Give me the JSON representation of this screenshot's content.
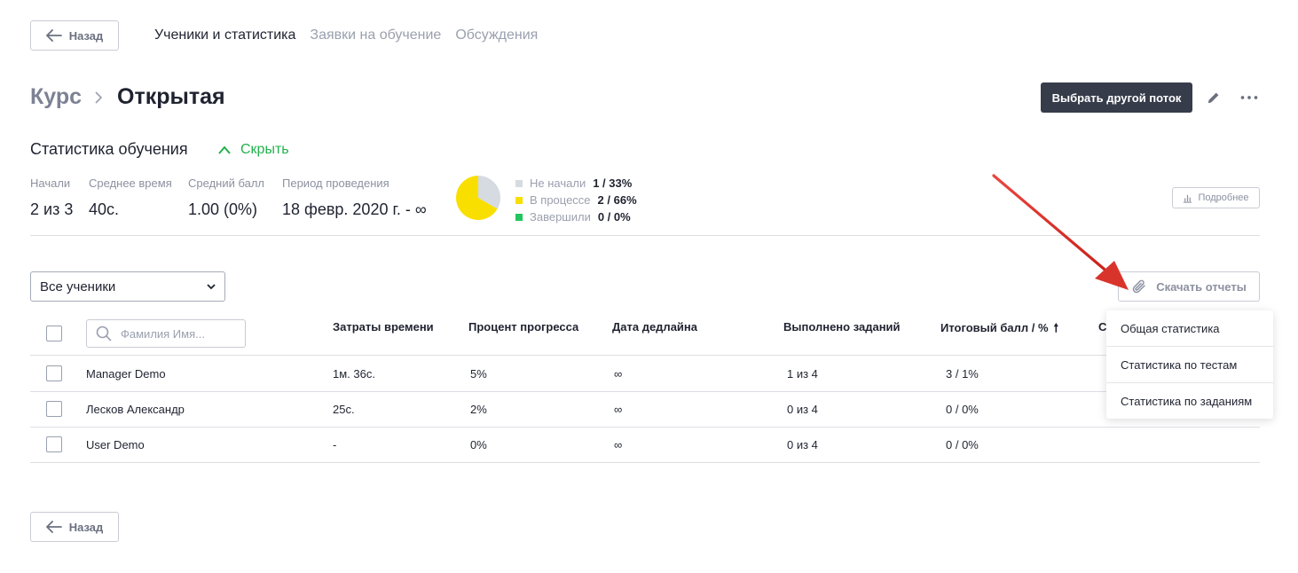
{
  "back_label": "Назад",
  "nav_tabs": [
    "Ученики и статистика",
    "Заявки на обучение",
    "Обсуждения"
  ],
  "breadcrumb": {
    "root": "Курс",
    "current": "Открытая"
  },
  "header": {
    "select_stream_label": "Выбрать другой поток",
    "edit_icon": "pencil-icon",
    "more_icon": "more-horizontal-icon"
  },
  "stats": {
    "title": "Статистика обучения",
    "collapse_label": "Скрыть",
    "items": [
      {
        "label": "Начали",
        "value": "2 из 3"
      },
      {
        "label": "Среднее время",
        "value": "40с."
      },
      {
        "label": "Средний балл",
        "value": "1.00 (0%)"
      },
      {
        "label": "Период проведения",
        "value": "18 февр. 2020 г. - ∞"
      }
    ],
    "details_label": "Подробнее"
  },
  "chart_data": {
    "type": "pie",
    "slices": [
      {
        "name": "Не начали",
        "label": "1 / 33%",
        "count": 1,
        "percent": 33,
        "color": "#d6dae1"
      },
      {
        "name": "В процессе",
        "label": "2 / 66%",
        "count": 2,
        "percent": 66,
        "color": "#f9df00"
      },
      {
        "name": "Завершили",
        "label": "0 / 0%",
        "count": 0,
        "percent": 0,
        "color": "#22c55e"
      }
    ]
  },
  "filter": {
    "selected": "Все ученики"
  },
  "download": {
    "label": "Скачать отчеты",
    "icon": "paperclip-icon"
  },
  "search": {
    "placeholder": "Фамилия Имя..."
  },
  "table": {
    "columns": [
      "Затраты времени",
      "Процент прогресса",
      "Дата дедлайна",
      "Выполнено заданий",
      "Итоговый балл / %",
      "С"
    ],
    "rows": [
      {
        "name": "Manager Demo",
        "time": "1м. 36с.",
        "progress": "5%",
        "deadline": "∞",
        "done": "1 из 4",
        "score": "3 / 1%"
      },
      {
        "name": "Лесков Александр",
        "time": "25с.",
        "progress": "2%",
        "deadline": "∞",
        "done": "0 из 4",
        "score": "0 / 0%"
      },
      {
        "name": "User Demo",
        "time": "-",
        "progress": "0%",
        "deadline": "∞",
        "done": "0 из 4",
        "score": "0 / 0%"
      }
    ]
  },
  "download_menu": [
    "Общая статистика",
    "Статистика по тестам",
    "Статистика по заданиям"
  ],
  "colors": {
    "accent_green": "#22b14c",
    "dark_button": "#363c4a",
    "annotation_arrow": "#d9342b"
  }
}
